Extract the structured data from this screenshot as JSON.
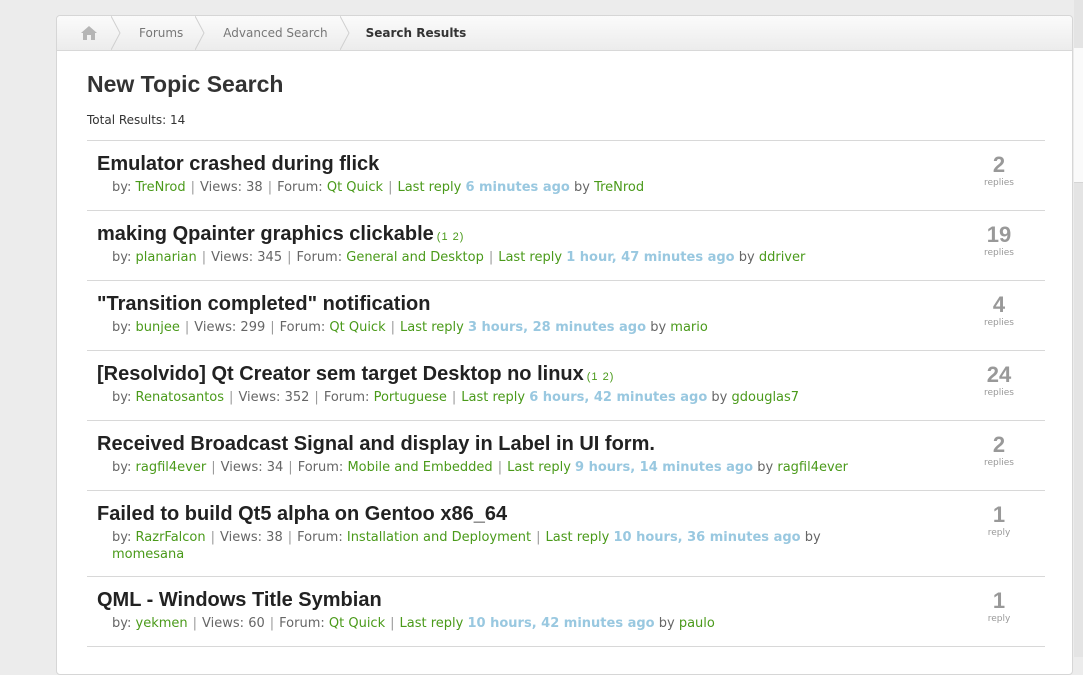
{
  "breadcrumb": {
    "home_icon": "home-icon",
    "items": [
      "Forums",
      "Advanced Search"
    ],
    "current": "Search Results"
  },
  "page": {
    "title": "New Topic Search",
    "total_label": "Total Results:",
    "total_value": "14"
  },
  "labels": {
    "by": "by:",
    "views": "Views:",
    "forum": "Forum:",
    "last_reply": "Last reply",
    "by_word": "by"
  },
  "topics": [
    {
      "title": "Emulator crashed during flick",
      "pages": [],
      "author": "TreNrod",
      "views": "38",
      "forum": "Qt Quick",
      "time": "6 minutes ago",
      "last_by": "TreNrod",
      "replies": "2",
      "replies_label": "replies"
    },
    {
      "title": "making Qpainter graphics clickable",
      "pages": [
        "1",
        "2"
      ],
      "author": "planarian",
      "views": "345",
      "forum": "General and Desktop",
      "time": "1 hour, 47 minutes ago",
      "last_by": "ddriver",
      "replies": "19",
      "replies_label": "replies"
    },
    {
      "title": "\"Transition completed\" notification",
      "pages": [],
      "author": "bunjee",
      "views": "299",
      "forum": "Qt Quick",
      "time": "3 hours, 28 minutes ago",
      "last_by": "mario",
      "replies": "4",
      "replies_label": "replies"
    },
    {
      "title": "[Resolvido] Qt Creator sem target Desktop no linux",
      "pages": [
        "1",
        "2"
      ],
      "author": "Renatosantos",
      "views": "352",
      "forum": "Portuguese",
      "time": "6 hours, 42 minutes ago",
      "last_by": "gdouglas7",
      "replies": "24",
      "replies_label": "replies"
    },
    {
      "title": "Received Broadcast Signal and display in Label in UI form.",
      "pages": [],
      "author": "ragfil4ever",
      "views": "34",
      "forum": "Mobile and Embedded",
      "time": "9 hours, 14 minutes ago",
      "last_by": "ragfil4ever",
      "replies": "2",
      "replies_label": "replies"
    },
    {
      "title": "Failed to build Qt5 alpha on Gentoo x86_64",
      "pages": [],
      "author": "RazrFalcon",
      "views": "38",
      "forum": "Installation and Deployment",
      "time": "10 hours, 36 minutes ago",
      "last_by": "momesana",
      "replies": "1",
      "replies_label": "reply"
    },
    {
      "title": "QML - Windows Title Symbian",
      "pages": [],
      "author": "yekmen",
      "views": "60",
      "forum": "Qt Quick",
      "time": "10 hours, 42 minutes ago",
      "last_by": "paulo",
      "replies": "1",
      "replies_label": "reply"
    }
  ],
  "colors": {
    "link": "#4a9a1a",
    "time": "#99c8e0",
    "count": "#999999"
  }
}
